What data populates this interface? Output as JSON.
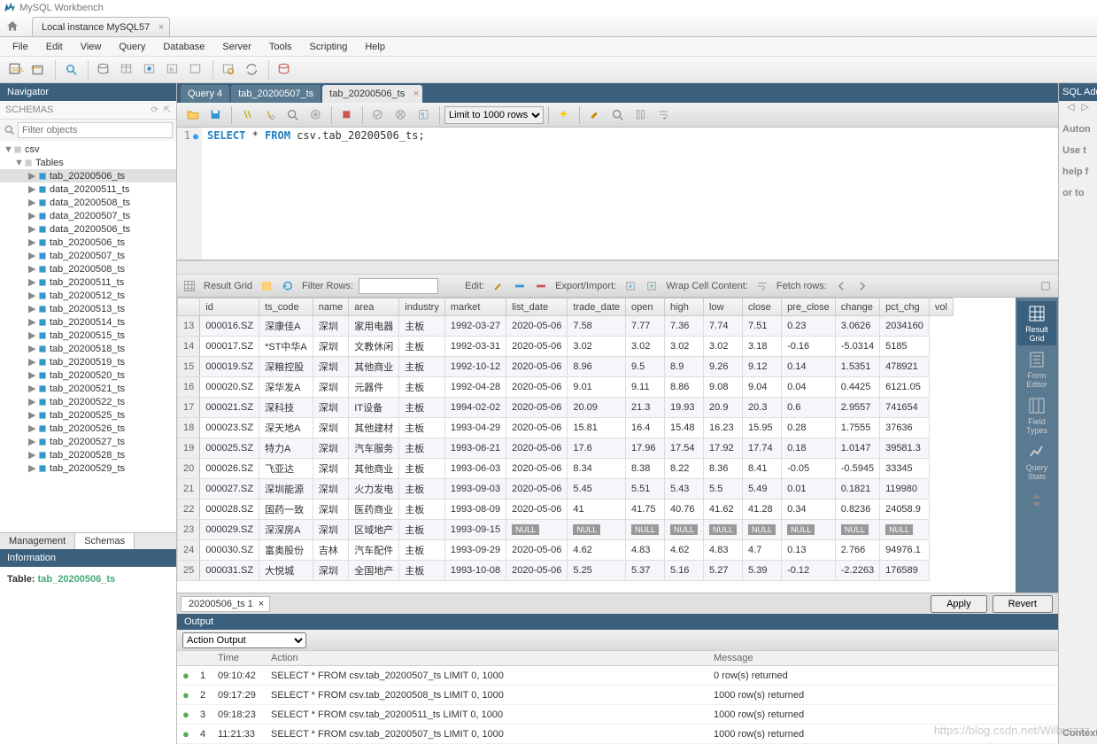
{
  "app": {
    "title": "MySQL Workbench"
  },
  "conn_tab": {
    "label": "Local instance MySQL57"
  },
  "menu": [
    "File",
    "Edit",
    "View",
    "Query",
    "Database",
    "Server",
    "Tools",
    "Scripting",
    "Help"
  ],
  "navigator": {
    "title": "Navigator",
    "schemas_label": "SCHEMAS",
    "filter_placeholder": "Filter objects",
    "db": "csv",
    "tables_label": "Tables",
    "tables": [
      "tab_20200506_ts",
      "data_20200511_ts",
      "data_20200508_ts",
      "data_20200507_ts",
      "data_20200506_ts",
      "tab_20200506_ts",
      "tab_20200507_ts",
      "tab_20200508_ts",
      "tab_20200511_ts",
      "tab_20200512_ts",
      "tab_20200513_ts",
      "tab_20200514_ts",
      "tab_20200515_ts",
      "tab_20200518_ts",
      "tab_20200519_ts",
      "tab_20200520_ts",
      "tab_20200521_ts",
      "tab_20200522_ts",
      "tab_20200525_ts",
      "tab_20200526_ts",
      "tab_20200527_ts",
      "tab_20200528_ts",
      "tab_20200529_ts"
    ],
    "selected_table": "tab_20200506_ts",
    "bottom_tabs": {
      "management": "Management",
      "schemas": "Schemas"
    },
    "info_title": "Information",
    "info_label": "Table:",
    "info_value": "tab_20200506_ts"
  },
  "editor": {
    "tabs": [
      {
        "label": "Query 4",
        "active": false
      },
      {
        "label": "tab_20200507_ts",
        "active": false
      },
      {
        "label": "tab_20200506_ts",
        "active": true
      }
    ],
    "limit_label": "Limit to 1000 rows",
    "code_line": "1",
    "sql_kw1": "SELECT",
    "sql_star": "*",
    "sql_kw2": "FROM",
    "sql_ident": "csv.tab_20200506_ts;"
  },
  "result": {
    "toolbar": {
      "grid_label": "Result Grid",
      "filter_label": "Filter Rows:",
      "edit_label": "Edit:",
      "export_label": "Export/Import:",
      "wrap_label": "Wrap Cell Content:",
      "fetch_label": "Fetch rows:"
    },
    "columns": [
      "id",
      "ts_code",
      "name",
      "area",
      "industry",
      "market",
      "list_date",
      "trade_date",
      "open",
      "high",
      "low",
      "close",
      "pre_close",
      "change",
      "pct_chg",
      "vol"
    ],
    "rows": [
      [
        "13",
        "000016.SZ",
        "深康佳A",
        "深圳",
        "家用电器",
        "主板",
        "1992-03-27",
        "2020-05-06",
        "7.58",
        "7.77",
        "7.36",
        "7.74",
        "7.51",
        "0.23",
        "3.0626",
        "2034160"
      ],
      [
        "14",
        "000017.SZ",
        "*ST中华A",
        "深圳",
        "文教休闲",
        "主板",
        "1992-03-31",
        "2020-05-06",
        "3.02",
        "3.02",
        "3.02",
        "3.02",
        "3.18",
        "-0.16",
        "-5.0314",
        "5185"
      ],
      [
        "15",
        "000019.SZ",
        "深粮控股",
        "深圳",
        "其他商业",
        "主板",
        "1992-10-12",
        "2020-05-06",
        "8.96",
        "9.5",
        "8.9",
        "9.26",
        "9.12",
        "0.14",
        "1.5351",
        "478921"
      ],
      [
        "16",
        "000020.SZ",
        "深华发A",
        "深圳",
        "元器件",
        "主板",
        "1992-04-28",
        "2020-05-06",
        "9.01",
        "9.11",
        "8.86",
        "9.08",
        "9.04",
        "0.04",
        "0.4425",
        "6121.05"
      ],
      [
        "17",
        "000021.SZ",
        "深科技",
        "深圳",
        "IT设备",
        "主板",
        "1994-02-02",
        "2020-05-06",
        "20.09",
        "21.3",
        "19.93",
        "20.9",
        "20.3",
        "0.6",
        "2.9557",
        "741654"
      ],
      [
        "18",
        "000023.SZ",
        "深天地A",
        "深圳",
        "其他建材",
        "主板",
        "1993-04-29",
        "2020-05-06",
        "15.81",
        "16.4",
        "15.48",
        "16.23",
        "15.95",
        "0.28",
        "1.7555",
        "37636"
      ],
      [
        "19",
        "000025.SZ",
        "特力A",
        "深圳",
        "汽车服务",
        "主板",
        "1993-06-21",
        "2020-05-06",
        "17.6",
        "17.96",
        "17.54",
        "17.92",
        "17.74",
        "0.18",
        "1.0147",
        "39581.3"
      ],
      [
        "20",
        "000026.SZ",
        "飞亚达",
        "深圳",
        "其他商业",
        "主板",
        "1993-06-03",
        "2020-05-06",
        "8.34",
        "8.38",
        "8.22",
        "8.36",
        "8.41",
        "-0.05",
        "-0.5945",
        "33345"
      ],
      [
        "21",
        "000027.SZ",
        "深圳能源",
        "深圳",
        "火力发电",
        "主板",
        "1993-09-03",
        "2020-05-06",
        "5.45",
        "5.51",
        "5.43",
        "5.5",
        "5.49",
        "0.01",
        "0.1821",
        "119980"
      ],
      [
        "22",
        "000028.SZ",
        "国药一致",
        "深圳",
        "医药商业",
        "主板",
        "1993-08-09",
        "2020-05-06",
        "41",
        "41.75",
        "40.76",
        "41.62",
        "41.28",
        "0.34",
        "0.8236",
        "24058.9"
      ],
      [
        "23",
        "000029.SZ",
        "深深房A",
        "深圳",
        "区域地产",
        "主板",
        "1993-09-15",
        "NULL",
        "NULL",
        "NULL",
        "NULL",
        "NULL",
        "NULL",
        "NULL",
        "NULL",
        "NULL"
      ],
      [
        "24",
        "000030.SZ",
        "富奥股份",
        "吉林",
        "汽车配件",
        "主板",
        "1993-09-29",
        "2020-05-06",
        "4.62",
        "4.83",
        "4.62",
        "4.83",
        "4.7",
        "0.13",
        "2.766",
        "94976.1"
      ],
      [
        "25",
        "000031.SZ",
        "大悦城",
        "深圳",
        "全国地产",
        "主板",
        "1993-10-08",
        "2020-05-06",
        "5.25",
        "5.37",
        "5.16",
        "5.27",
        "5.39",
        "-0.12",
        "-2.2263",
        "176589"
      ]
    ],
    "side_tabs": [
      {
        "label": "Result\nGrid",
        "active": true
      },
      {
        "label": "Form\nEditor",
        "active": false
      },
      {
        "label": "Field\nTypes",
        "active": false
      },
      {
        "label": "Query\nStats",
        "active": false
      }
    ],
    "footer_tab": "20200506_ts 1",
    "apply": "Apply",
    "revert": "Revert"
  },
  "output": {
    "title": "Output",
    "dropdown": "Action Output",
    "headers": [
      "",
      "",
      "Time",
      "Action",
      "Message"
    ],
    "rows": [
      {
        "n": "1",
        "time": "09:10:42",
        "action": "SELECT * FROM csv.tab_20200507_ts LIMIT 0, 1000",
        "msg": "0 row(s) returned"
      },
      {
        "n": "2",
        "time": "09:17:29",
        "action": "SELECT * FROM csv.tab_20200508_ts LIMIT 0, 1000",
        "msg": "1000 row(s) returned"
      },
      {
        "n": "3",
        "time": "09:18:23",
        "action": "SELECT * FROM csv.tab_20200511_ts LIMIT 0, 1000",
        "msg": "1000 row(s) returned"
      },
      {
        "n": "4",
        "time": "11:21:33",
        "action": "SELECT * FROM csv.tab_20200507_ts LIMIT 0, 1000",
        "msg": "1000 row(s) returned"
      }
    ]
  },
  "right": {
    "title": "SQL Add",
    "line1": "Auton",
    "line2": "Use t",
    "line3": "help f",
    "line4": "or to",
    "footer": "Context"
  },
  "watermark": "https://blog.csdn.net/Wilburzzz"
}
